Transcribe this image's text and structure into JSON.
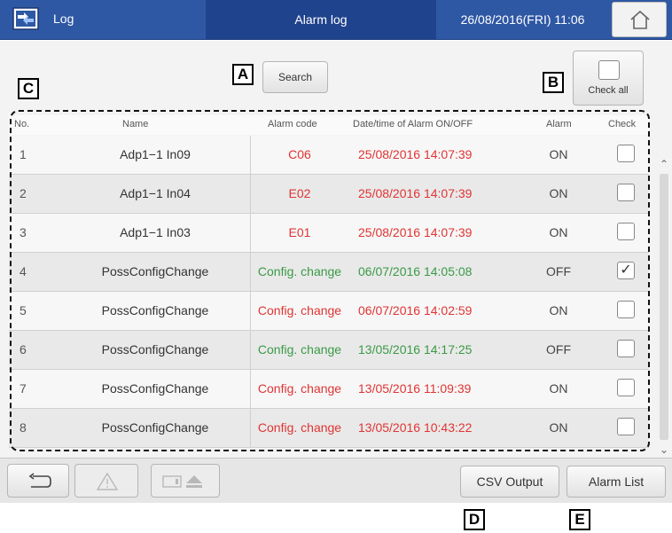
{
  "titlebar": {
    "log_label": "Log",
    "screen_title": "Alarm log",
    "datetime": "26/08/2016(FRI) 11:06"
  },
  "toolbar": {
    "search_label": "Search",
    "check_all_label": "Check all"
  },
  "callouts": {
    "a": "A",
    "b": "B",
    "c": "C",
    "d": "D",
    "e": "E"
  },
  "table": {
    "headers": {
      "no": "No.",
      "name": "Name",
      "code": "Alarm code",
      "datetime": "Date/time of Alarm ON/OFF",
      "alarm": "Alarm",
      "check": "Check"
    },
    "rows": [
      {
        "no": "1",
        "name": "Adp1−1 In09",
        "code": "C06",
        "datetime": "25/08/2016 14:07:39",
        "alarm": "ON",
        "checked": ""
      },
      {
        "no": "2",
        "name": "Adp1−1 In04",
        "code": "E02",
        "datetime": "25/08/2016 14:07:39",
        "alarm": "ON",
        "checked": ""
      },
      {
        "no": "3",
        "name": "Adp1−1 In03",
        "code": "E01",
        "datetime": "25/08/2016 14:07:39",
        "alarm": "ON",
        "checked": ""
      },
      {
        "no": "4",
        "name": "PossConfigChange",
        "code": "Config. change",
        "datetime": "06/07/2016 14:05:08",
        "alarm": "OFF",
        "checked": "✓"
      },
      {
        "no": "5",
        "name": "PossConfigChange",
        "code": "Config. change",
        "datetime": "06/07/2016 14:02:59",
        "alarm": "ON",
        "checked": ""
      },
      {
        "no": "6",
        "name": "PossConfigChange",
        "code": "Config. change",
        "datetime": "13/05/2016 14:17:25",
        "alarm": "OFF",
        "checked": ""
      },
      {
        "no": "7",
        "name": "PossConfigChange",
        "code": "Config. change",
        "datetime": "13/05/2016 11:09:39",
        "alarm": "ON",
        "checked": ""
      },
      {
        "no": "8",
        "name": "PossConfigChange",
        "code": "Config. change",
        "datetime": "13/05/2016 10:43:22",
        "alarm": "ON",
        "checked": ""
      }
    ]
  },
  "bottombar": {
    "csv_output_label": "CSV Output",
    "alarm_list_label": "Alarm List"
  },
  "colors": {
    "titlebar": "#2f58a4",
    "alarm_on": "#e03434",
    "alarm_off": "#3a9a46"
  }
}
